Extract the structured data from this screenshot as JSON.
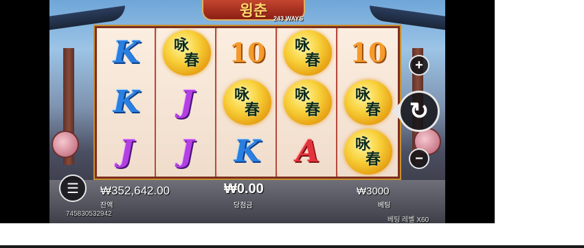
{
  "game": {
    "title": "윙춘",
    "ways_label": "243 WAYS"
  },
  "reels": [
    [
      "K",
      "K",
      "J"
    ],
    [
      "wild",
      "J",
      "J"
    ],
    [
      "10",
      "wild",
      "K"
    ],
    [
      "wild",
      "wild",
      "A"
    ],
    [
      "10",
      "wild",
      "wild"
    ]
  ],
  "wild_symbol": {
    "char_top": "咏",
    "char_bottom": "春"
  },
  "hud": {
    "balance_value": "₩352,642.00",
    "balance_label": "잔액",
    "win_value": "₩0.00",
    "win_label": "당첨금",
    "bet_value": "₩3000",
    "bet_label": "베팅",
    "session_id": "745830532942",
    "bet_level": "베팅 레벨  X60"
  },
  "controls": {
    "plus": "+",
    "minus": "−",
    "spin": "↻",
    "menu": "☰"
  },
  "colors": {
    "frame": "#7b2e1f",
    "wild": "#f8d03a",
    "K": "#2a7fe0",
    "J": "#b340e3",
    "A": "#e4333a",
    "ten": "#f59a2b"
  }
}
